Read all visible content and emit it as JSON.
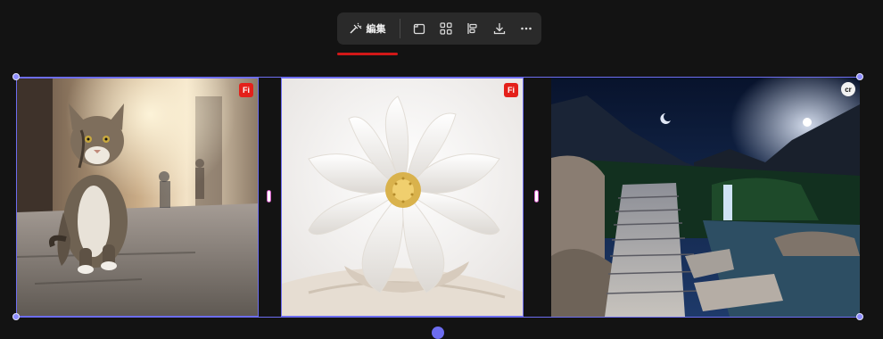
{
  "toolbar": {
    "edit_label": "編集",
    "buttons": [
      {
        "name": "edit-sparkle-icon"
      },
      {
        "name": "resize-icon"
      },
      {
        "name": "grid-apps-icon"
      },
      {
        "name": "align-icon"
      },
      {
        "name": "download-icon"
      },
      {
        "name": "more-icon"
      }
    ]
  },
  "images": [
    {
      "subject": "cat-walking-street",
      "badge": "Fi"
    },
    {
      "subject": "white-lotus-flower",
      "badge": "Fi"
    },
    {
      "subject": "night-mountain-stairs-waterfall",
      "badge": "cr"
    }
  ],
  "colors": {
    "background": "#131313",
    "toolbar": "#2a2a2a",
    "selection": "#6d6df0",
    "accent_red": "#d11818"
  }
}
